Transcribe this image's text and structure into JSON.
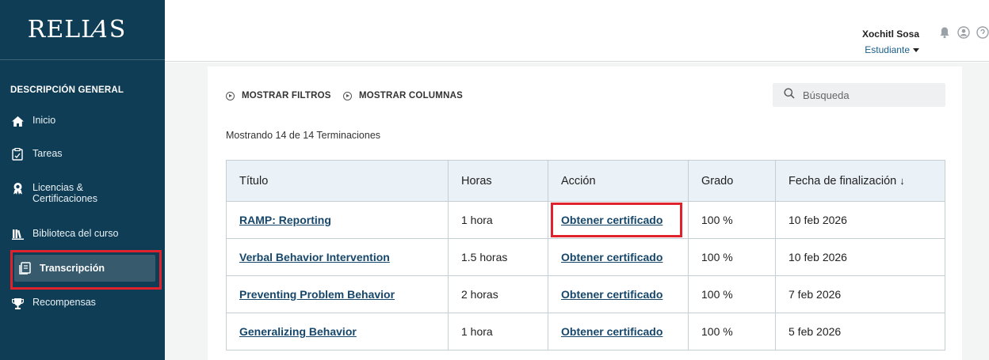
{
  "brand": {
    "logo_text_1": "RELI",
    "logo_text_2": "A",
    "logo_text_3": "S"
  },
  "sidebar": {
    "heading": "DESCRIPCIÓN GENERAL",
    "items": [
      {
        "label": "Inicio",
        "icon": "home-icon"
      },
      {
        "label": "Tareas",
        "icon": "clipboard-icon"
      },
      {
        "label": "Licencias &",
        "label2": "Certificaciones",
        "icon": "award-icon"
      },
      {
        "label": "Biblioteca del curso",
        "icon": "library-icon"
      },
      {
        "label": "Transcripción",
        "icon": "transcript-icon",
        "active": true
      },
      {
        "label": "Recompensas",
        "icon": "trophy-icon"
      }
    ]
  },
  "header": {
    "user_name": "Xochitl Sosa",
    "user_role": "Estudiante"
  },
  "toolbar": {
    "show_filters": "MOSTRAR FILTROS",
    "show_columns": "MOSTRAR COLUMNAS",
    "search_placeholder": "Búsqueda"
  },
  "results": {
    "count_text": "Mostrando 14 de 14 Terminaciones"
  },
  "table": {
    "headers": {
      "title": "Título",
      "hours": "Horas",
      "action": "Acción",
      "grade": "Grado",
      "date": "Fecha de finalización",
      "sort_arrow": "↓"
    },
    "rows": [
      {
        "title": "RAMP: Reporting",
        "hours": "1 hora",
        "action": "Obtener certificado",
        "grade": "100 %",
        "date": "10 feb 2026"
      },
      {
        "title": "Verbal Behavior Intervention",
        "hours": "1.5 horas",
        "action": "Obtener certificado",
        "grade": "100 %",
        "date": "10 feb 2026"
      },
      {
        "title": "Preventing Problem Behavior",
        "hours": "2 horas",
        "action": "Obtener certificado",
        "grade": "100 %",
        "date": "7 feb 2026"
      },
      {
        "title": "Generalizing Behavior",
        "hours": "1 hora",
        "action": "Obtener certificado",
        "grade": "100 %",
        "date": "5 feb 2026"
      }
    ]
  },
  "colors": {
    "sidebar_bg": "#0f3d55",
    "highlight": "#e0222c",
    "link": "#16476b",
    "table_header_bg": "#eaf1f7"
  }
}
